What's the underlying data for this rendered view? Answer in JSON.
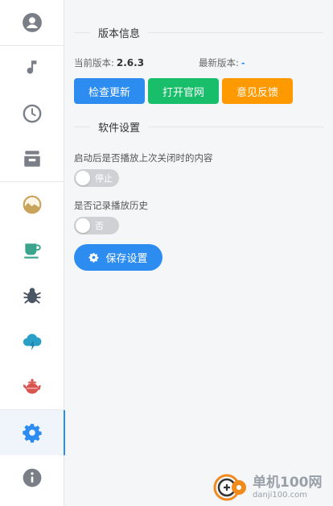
{
  "sidebar": {
    "items": [
      {
        "name": "user",
        "icon": "user-circle-icon",
        "color": "#7a7f87"
      },
      {
        "name": "music",
        "icon": "music-note-icon",
        "color": "#7a7f87"
      },
      {
        "name": "clock",
        "icon": "clock-icon",
        "color": "#7a7f87"
      },
      {
        "name": "inbox",
        "icon": "inbox-tray-icon",
        "color": "#7a7f87"
      },
      {
        "name": "landscape",
        "icon": "landscape-icon",
        "color": "#c9a35a"
      },
      {
        "name": "coffee",
        "icon": "coffee-cup-icon",
        "color": "#3aa58c"
      },
      {
        "name": "bug",
        "icon": "bug-icon",
        "color": "#4a5666"
      },
      {
        "name": "cloud",
        "icon": "cloud-bolt-icon",
        "color": "#2aa0c8"
      },
      {
        "name": "teapot",
        "icon": "teapot-icon",
        "color": "#d9534f"
      },
      {
        "name": "settings",
        "icon": "gear-icon",
        "color": "#2d8cf0",
        "active": true
      },
      {
        "name": "about",
        "icon": "info-icon",
        "color": "#7a7f87"
      }
    ]
  },
  "version_section": {
    "title": "版本信息",
    "current_label": "当前版本:",
    "current_value": "2.6.3",
    "latest_label": "最新版本:",
    "latest_value": "-",
    "buttons": {
      "check_update": "检查更新",
      "open_site": "打开官网",
      "feedback": "意见反馈"
    }
  },
  "settings_section": {
    "title": "软件设置",
    "option1_label": "启动后是否播放上次关闭时的内容",
    "option1_value": "停止",
    "option2_label": "是否记录播放历史",
    "option2_value": "否",
    "save_label": "保存设置"
  },
  "watermark": {
    "title": "单机100网",
    "url": "danji100.com"
  },
  "colors": {
    "accent": "#2d8cf0",
    "green": "#19be6b",
    "orange": "#ff9900"
  }
}
